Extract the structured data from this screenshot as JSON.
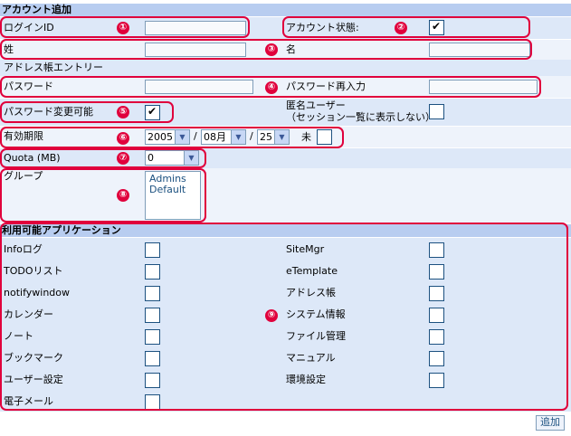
{
  "section_title": "アカウント追加",
  "login_id_label": "ログインID",
  "account_status_label": "アカウント状態:",
  "account_status_checked": true,
  "last_name_label": "姓",
  "first_name_label": "名",
  "address_book_label": "アドレス帳エントリー",
  "password_label": "パスワード",
  "password_confirm_label": "パスワード再入力",
  "password_changeable_label": "パスワード変更可能",
  "password_changeable_checked": true,
  "anonymous_label_line1": "匿名ユーザー",
  "anonymous_label_line2": "（セッション一覧に表示しない）",
  "expiry_label": "有効期限",
  "expiry_year": "2005",
  "expiry_month": "08月",
  "expiry_day": "25",
  "date_sep": "/",
  "never_label": "未",
  "quota_label": "Quota (MB)",
  "quota_value": "0",
  "group_label": "グループ",
  "groups": [
    "Admins",
    "Default"
  ],
  "apps_title": "利用可能アプリケーション",
  "apps_left": [
    "Infoログ",
    "TODOリスト",
    "notifywindow",
    "カレンダー",
    "ノート",
    "ブックマーク",
    "ユーザー設定",
    "電子メール"
  ],
  "apps_right": [
    "SiteMgr",
    "eTemplate",
    "アドレス帳",
    "システム情報",
    "ファイル管理",
    "マニュアル",
    "環境設定"
  ],
  "add_button": "追加",
  "markers": [
    "①",
    "②",
    "③",
    "④",
    "⑤",
    "⑥",
    "⑦",
    "⑧",
    "⑨"
  ],
  "dropdown_arrow": "▼",
  "colors": {
    "header": "#b8cdf0",
    "row_a": "#dde8f8",
    "row_b": "#eef3fb",
    "annotation": "#e0003c"
  }
}
